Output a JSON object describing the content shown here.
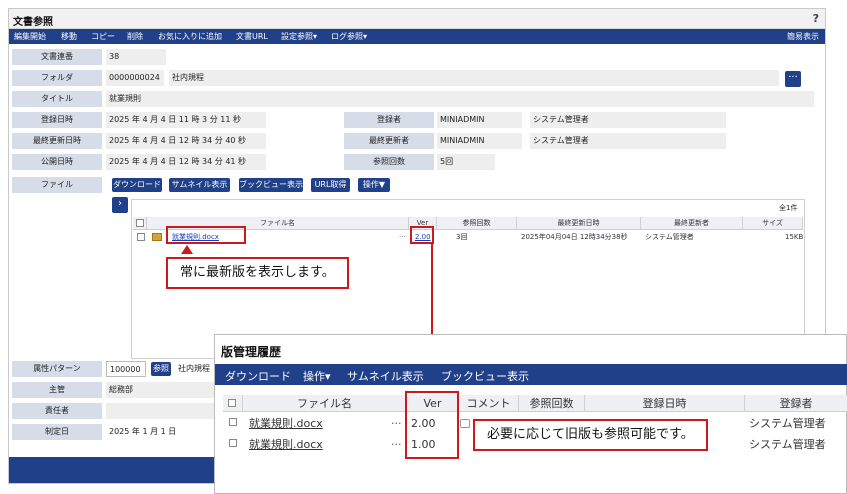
{
  "window": {
    "title": "文書参照",
    "help": "?"
  },
  "menu": {
    "items": [
      "編集開始",
      "移動",
      "コピー",
      "削除",
      "お気に入りに追加",
      "文書URL",
      "設定参照▾",
      "ログ参照▾"
    ],
    "right": "簡易表示"
  },
  "fields": {
    "doc_no_label": "文書連番",
    "doc_no": "38",
    "folder_label": "フォルダ",
    "folder_code": "0000000024",
    "folder_name": "社内規程",
    "folder_btn": "···",
    "title_label": "タイトル",
    "title": "就業規則",
    "reg_label": "登録日時",
    "reg_date": "2025 年 4 月 4 日 11 時 3 分 11 秒",
    "upd_label": "最終更新日時",
    "upd_date": "2025 年 4 月 4 日 12 時 34 分 40 秒",
    "pub_label": "公開日時",
    "pub_date": "2025 年 4 月 4 日 12 時 34 分 41 秒",
    "registrant_label": "登録者",
    "registrant_id": "MINIADMIN",
    "registrant_name": "システム管理者",
    "updater_label": "最終更新者",
    "updater_id": "MINIADMIN",
    "updater_name": "システム管理者",
    "views_label": "参照回数",
    "views": "5回",
    "file_label": "ファイル"
  },
  "file_buttons": [
    "ダウンロード",
    "サムネイル表示",
    "ブックビュー表示",
    "URL取得",
    "操作▼"
  ],
  "file_table": {
    "count": "全1件",
    "headers": [
      "ファイル名",
      "Ver",
      "参照回数",
      "最終更新日時",
      "最終更新者",
      "サイズ"
    ],
    "row": {
      "name": "就業規則.docx",
      "ver": "2.00",
      "views": "3回",
      "updated": "2025年04月04日 12時34分38秒",
      "updater": "システム管理者",
      "size": "15KB"
    }
  },
  "callout1": "常に最新版を表示します。",
  "lower_fields": {
    "attr_label": "属性パターン",
    "attr_code": "100000",
    "attr_btn": "参照",
    "attr_name": "社内規程",
    "owner_label": "主管",
    "owner": "総務部",
    "resp_label": "責任者",
    "resp": "",
    "enact_label": "制定日",
    "enact_date": "2025 年 1 月 1 日"
  },
  "history": {
    "title": "版管理履歴",
    "menu": [
      "ダウンロード",
      "操作▾",
      "サムネイル表示",
      "ブックビュー表示"
    ],
    "headers": [
      "ファイル名",
      "Ver",
      "コメント",
      "参照回数",
      "登録日時",
      "登録者"
    ],
    "rows": [
      {
        "name": "就業規則.docx",
        "ver": "2.00",
        "registrant": "システム管理者"
      },
      {
        "name": "就業規則.docx",
        "ver": "1.00",
        "registrant": "システム管理者"
      }
    ]
  },
  "callout2": "必要に応じて旧版も参照可能です。",
  "colors": {
    "brand": "#20408a",
    "label_bg": "#d6dde8",
    "callout_red": "#d0171c"
  }
}
